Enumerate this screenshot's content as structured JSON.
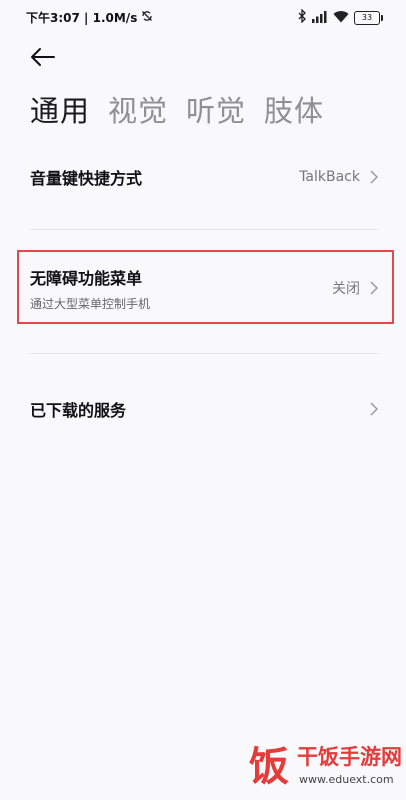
{
  "status_bar": {
    "time": "下午3:07",
    "network_speed": "1.0M/s",
    "battery_level": "33",
    "icons": [
      "sync-off-icon",
      "bluetooth-icon",
      "signal-icon",
      "wifi-icon",
      "battery-icon"
    ]
  },
  "header": {
    "back_icon": "arrow-left-icon"
  },
  "tabs": [
    {
      "label": "通用",
      "active": true
    },
    {
      "label": "视觉",
      "active": false
    },
    {
      "label": "听觉",
      "active": false
    },
    {
      "label": "肢体",
      "active": false
    }
  ],
  "settings": {
    "volume_shortcut": {
      "title": "音量键快捷方式",
      "value": "TalkBack"
    },
    "accessibility_menu": {
      "title": "无障碍功能菜单",
      "subtitle": "通过大型菜单控制手机",
      "value": "关闭"
    },
    "downloaded_services": {
      "title": "已下载的服务"
    }
  },
  "highlight_color": "#e2494b",
  "watermark": {
    "logo_char": "饭",
    "name": "干饭手游网",
    "url": "www.eduext.com"
  }
}
